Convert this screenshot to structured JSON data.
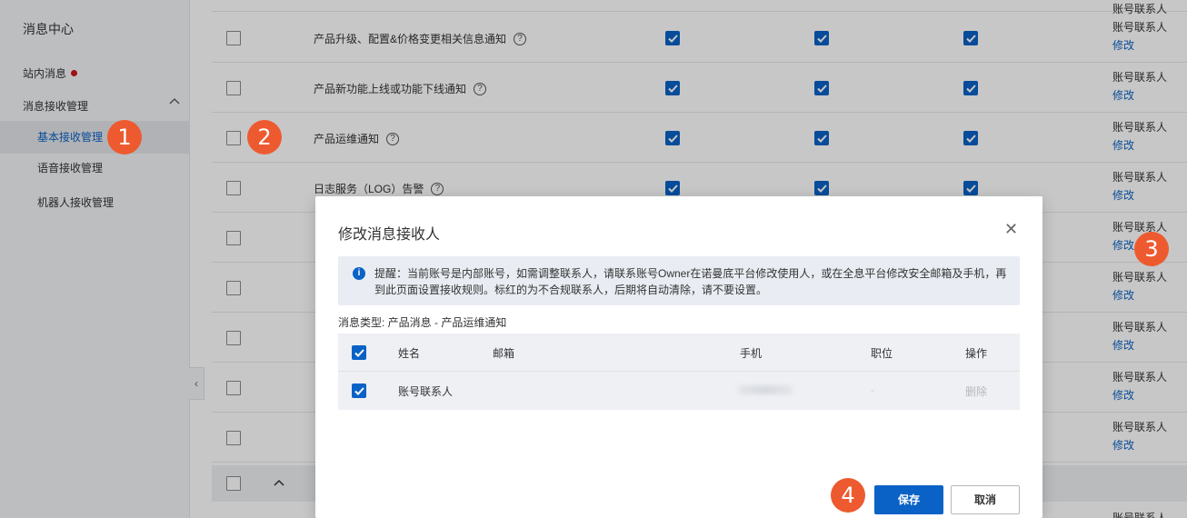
{
  "sidebar": {
    "title": "消息中心",
    "inbox_label": "站内消息",
    "manage_label": "消息接收管理",
    "sub_items": [
      {
        "label": "基本接收管理"
      },
      {
        "label": "语音接收管理"
      },
      {
        "label": "机器人接收管理"
      }
    ]
  },
  "table": {
    "rows": [
      {
        "name": "产品升级、配置&价格变更相关信息通知",
        "contact": "账号联系人",
        "edit": "修改"
      },
      {
        "name": "产品新功能上线或功能下线通知",
        "contact": "账号联系人",
        "edit": "修改"
      },
      {
        "name": "产品运维通知",
        "contact": "账号联系人",
        "edit": "修改"
      },
      {
        "name": "日志服务（LOG）告警",
        "contact": "账号联系人",
        "edit": "修改"
      },
      {
        "name": "",
        "contact": "账号联系人",
        "edit": "修改"
      },
      {
        "name": "",
        "contact": "账号联系人",
        "edit": "修改"
      },
      {
        "name": "",
        "contact": "账号联系人",
        "edit": "修改"
      },
      {
        "name": "",
        "contact": "账号联系人",
        "edit": "修改"
      },
      {
        "name": "",
        "contact": "账号联系人",
        "edit": "修改"
      }
    ],
    "top_contact": "账号联系人",
    "bottom_contact": "账号联系人"
  },
  "modal": {
    "title": "修改消息接收人",
    "alert_text": "提醒：当前账号是内部账号，如需调整联系人，请联系账号Owner在诺曼底平台修改使用人，或在全息平台修改安全邮箱及手机，再到此页面设置接收规则。标红的为不合规联系人，后期将自动清除，请不要设置。",
    "message_type": "消息类型: 产品消息 - 产品运维通知",
    "columns": [
      "姓名",
      "邮箱",
      "手机",
      "职位",
      "操作"
    ],
    "rows": [
      {
        "name": "账号联系人",
        "position": "-",
        "action": "删除"
      }
    ],
    "save_label": "保存",
    "cancel_label": "取消"
  },
  "steps": [
    "1",
    "2",
    "3",
    "4"
  ],
  "colors": {
    "primary": "#0a62c6",
    "step_marker": "#ee5a2f",
    "notification_dot": "#c9171c"
  }
}
